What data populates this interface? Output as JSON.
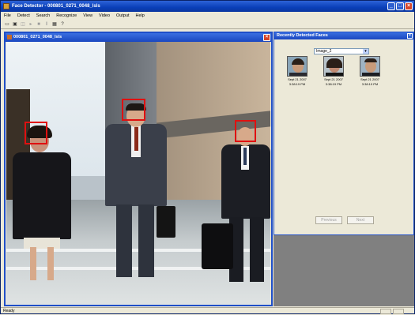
{
  "window": {
    "title": "Face Detector - 000801_0271_0048_lsls"
  },
  "menu": [
    "File",
    "Detect",
    "Search",
    "Recognize",
    "View",
    "Video",
    "Output",
    "Help"
  ],
  "toolbar": [
    "open-icon",
    "save-icon",
    "disk-icon",
    "play-icon",
    "stop-icon",
    "pause-icon",
    "grid-icon",
    "help-icon"
  ],
  "document": {
    "title": "000801_0271_0048_lsls"
  },
  "side_panel": {
    "title": "Recently Detected Faces",
    "dropdown_value": "Image_2",
    "faces": [
      {
        "date": "Sept 21 2007",
        "time": "3:38:19 PM"
      },
      {
        "date": "Sept 21 2007",
        "time": "3:38:19 PM"
      },
      {
        "date": "Sept 21 2007",
        "time": "3:38:19 PM"
      }
    ],
    "prev_label": "Previous",
    "next_label": "Next"
  },
  "status": {
    "text": "Ready"
  },
  "colors": {
    "detection_box": "#E01010",
    "title_blue": "#1F4FC8"
  }
}
